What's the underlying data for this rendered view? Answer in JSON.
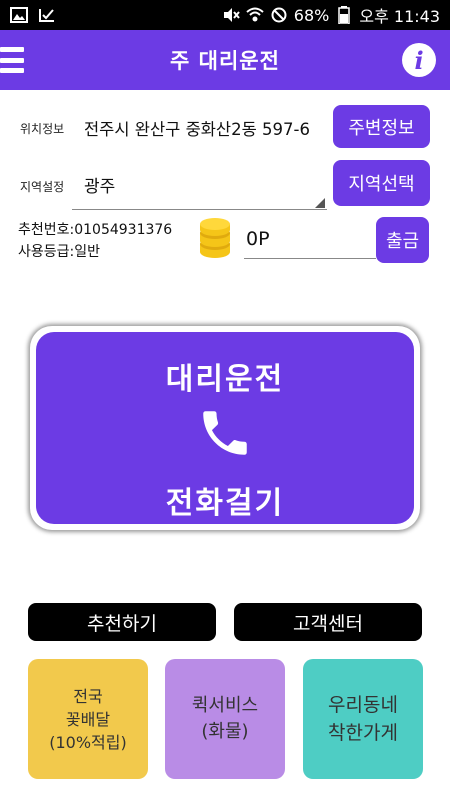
{
  "status_bar": {
    "battery": "68%",
    "time": "오후 11:43"
  },
  "app": {
    "title": "주 대리운전"
  },
  "location": {
    "label": "위치정보",
    "value": "전주시 완산구 중화산2동 597-6",
    "button": "주변정보"
  },
  "region": {
    "label": "지역설정",
    "value": "광주",
    "button": "지역선택"
  },
  "account": {
    "recommend_no": "추천번호:01054931376",
    "grade": "사용등급:일반",
    "points": "0P",
    "withdraw_button": "출금"
  },
  "call_button": {
    "top_text": "대리운전",
    "bottom_text": "전화걸기",
    "icon": "phone-icon"
  },
  "actions": {
    "recommend": "추천하기",
    "customer_center": "고객센터"
  },
  "tiles": [
    {
      "lines": [
        "전국",
        "꽃배달",
        "(10%적립)"
      ],
      "color": "#f2c94c"
    },
    {
      "lines": [
        "퀵서비스",
        "(화물)"
      ],
      "color": "#b98ce6"
    },
    {
      "lines": [
        "우리동네",
        "착한가게"
      ],
      "color": "#4ecdc4"
    }
  ],
  "colors": {
    "primary": "#6c3be4",
    "coin": "#f5c518"
  }
}
